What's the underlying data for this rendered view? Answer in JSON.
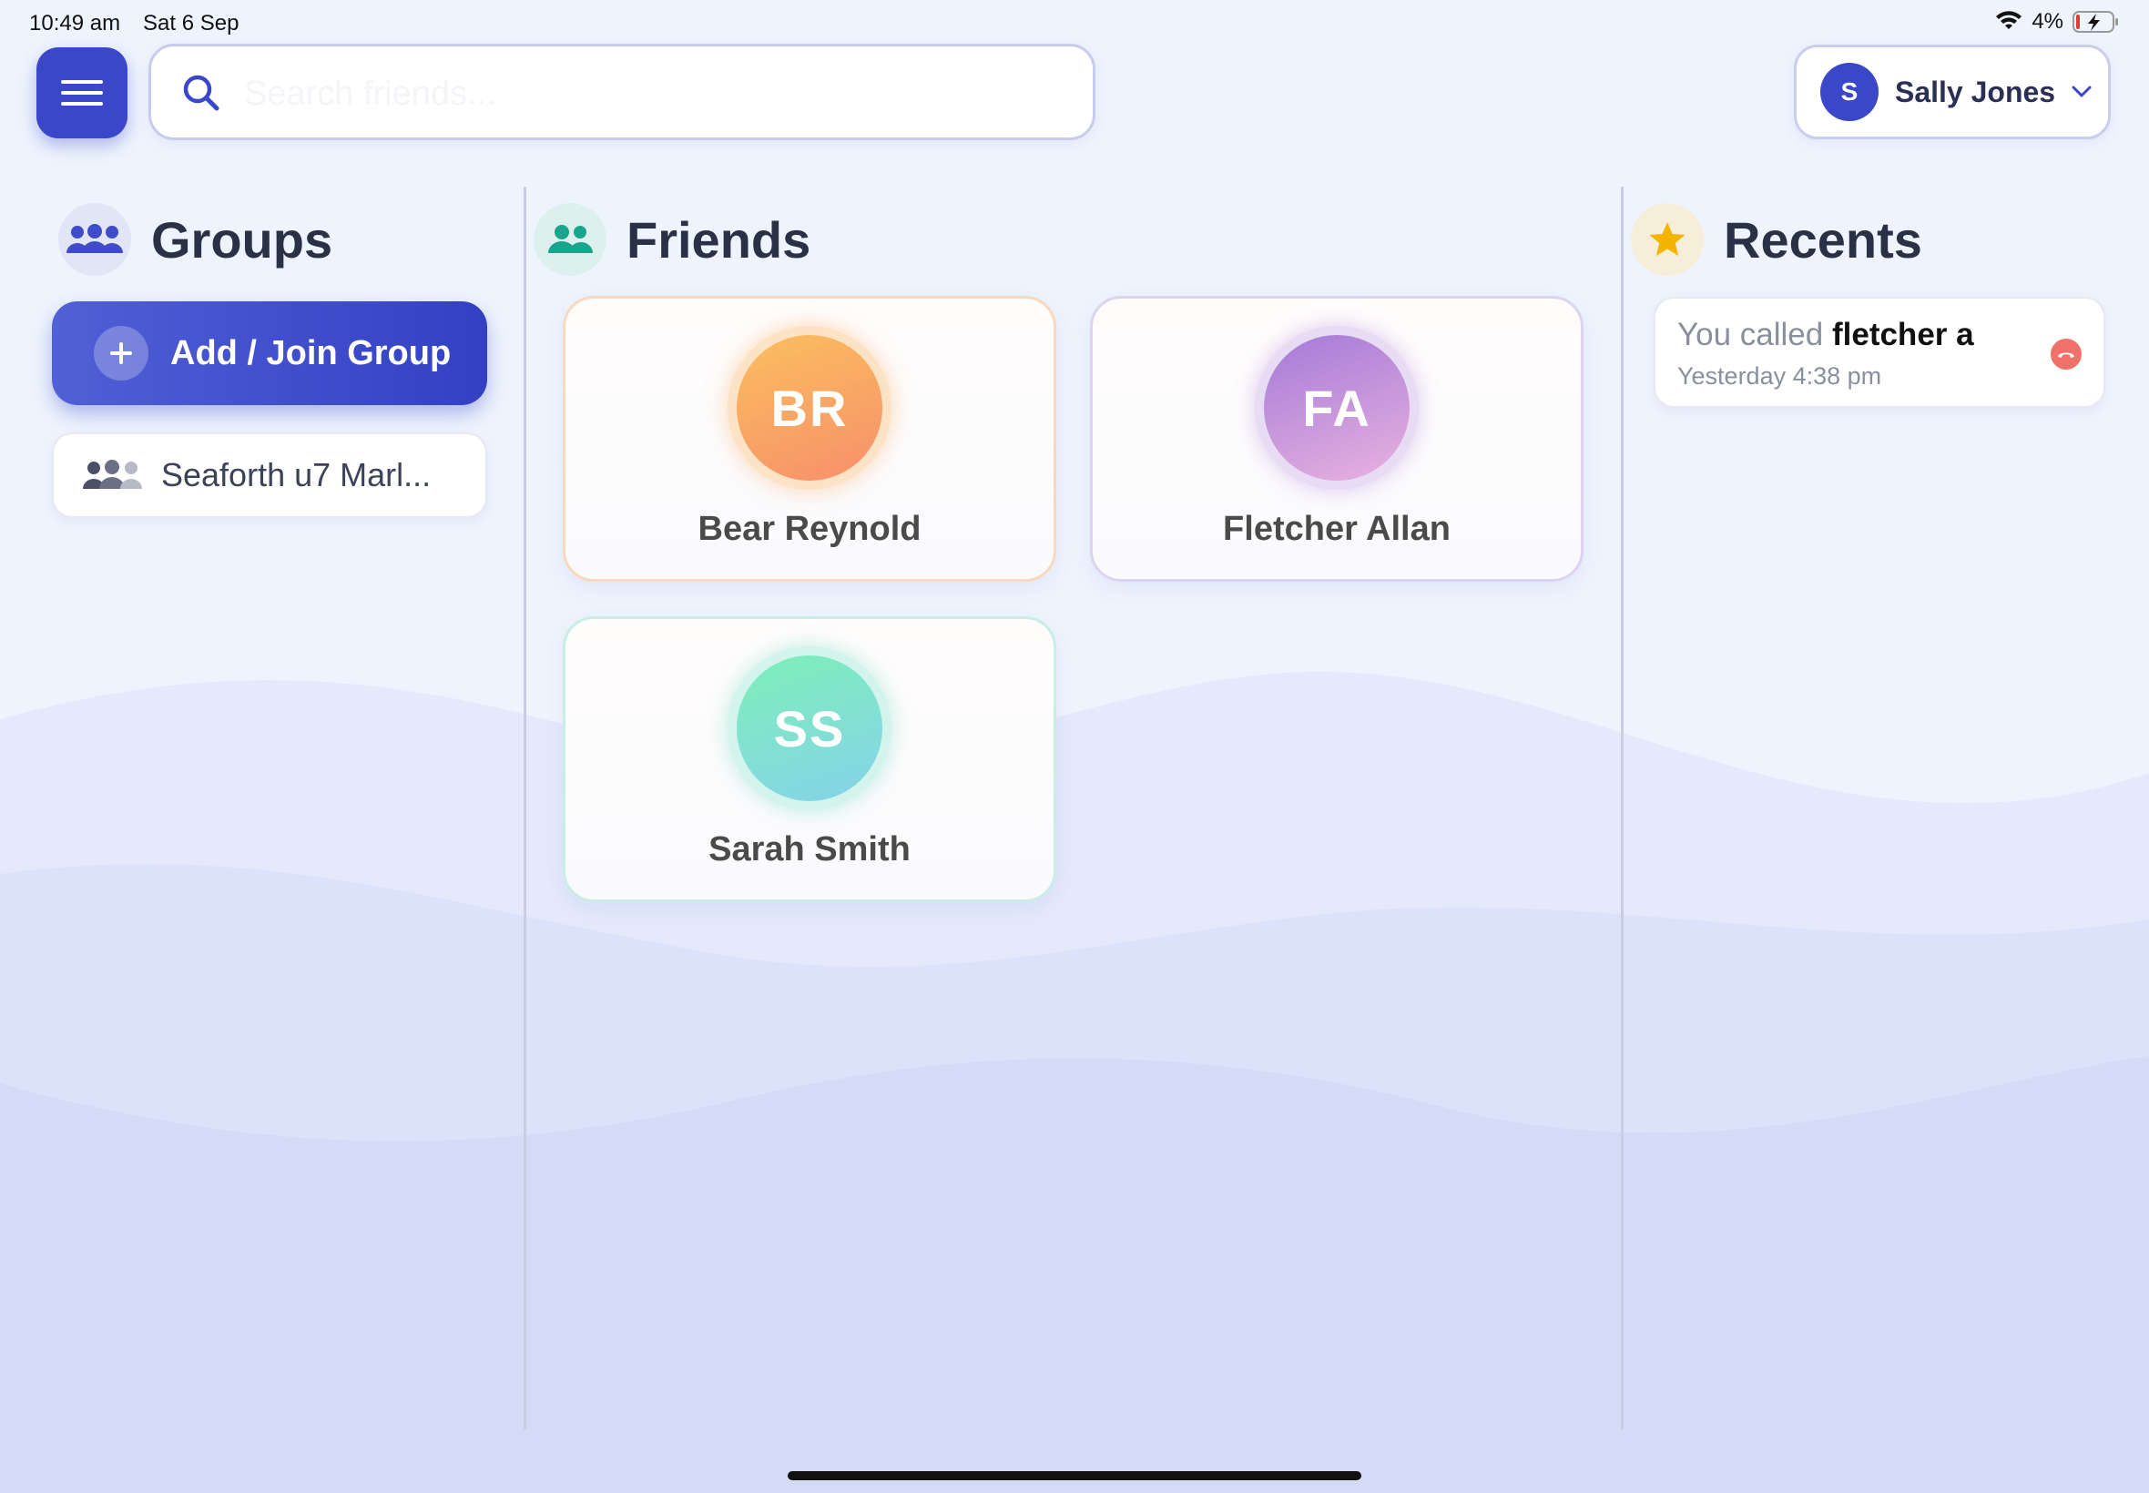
{
  "status_bar": {
    "time": "10:49 am",
    "date": "Sat 6 Sep",
    "battery": "4%"
  },
  "search": {
    "placeholder": "Search friends..."
  },
  "user": {
    "initial": "S",
    "name": "Sally Jones"
  },
  "groups": {
    "title": "Groups",
    "add_label": "Add / Join Group",
    "items": [
      {
        "label": "Seaforth u7 Marl..."
      }
    ]
  },
  "friends": {
    "title": "Friends",
    "items": [
      {
        "initials": "BR",
        "name": "Bear Reynold"
      },
      {
        "initials": "FA",
        "name": "Fletcher Allan"
      },
      {
        "initials": "SS",
        "name": "Sarah Smith"
      }
    ]
  },
  "recents": {
    "title": "Recents",
    "items": [
      {
        "prefix": "You called",
        "contact": "fletcher a",
        "time": "Yesterday 4:38 pm"
      }
    ]
  },
  "colors": {
    "accent": "#3a47c8",
    "groups_icon": "#3f4bc9",
    "friends_icon": "#18a58c",
    "recents_icon": "#f5b400",
    "hangup": "#f0706a"
  },
  "icons": {
    "menu": "menu-icon",
    "search": "search-icon",
    "chevron": "chevron-down-icon",
    "groups": "groups-icon",
    "friends": "friends-icon",
    "recents": "star-icon",
    "hangup": "phone-hangup-icon"
  }
}
